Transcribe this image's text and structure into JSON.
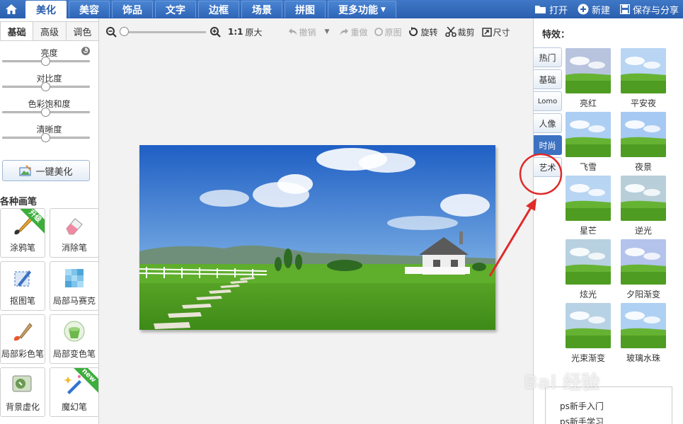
{
  "topbar": {
    "tabs": [
      {
        "label": "美化",
        "active": true
      },
      {
        "label": "美容"
      },
      {
        "label": "饰品"
      },
      {
        "label": "文字"
      },
      {
        "label": "边框"
      },
      {
        "label": "场景"
      },
      {
        "label": "拼图"
      },
      {
        "label": "更多功能"
      }
    ],
    "actions": {
      "open": "打开",
      "new": "新建",
      "save_share": "保存与分享"
    }
  },
  "left": {
    "subtabs": [
      "基础",
      "高级",
      "调色"
    ],
    "sliders": [
      {
        "label": "亮度",
        "value": 0.5
      },
      {
        "label": "对比度",
        "value": 0.5
      },
      {
        "label": "色彩饱和度",
        "value": 0.5
      },
      {
        "label": "清晰度",
        "value": 0.5
      }
    ],
    "onekey_label": "一键美化",
    "brush_section": "各种画笔",
    "brushes": [
      {
        "label": "涂鸦笔",
        "badge": "升级"
      },
      {
        "label": "消除笔"
      },
      {
        "label": "抠图笔"
      },
      {
        "label": "局部马赛克"
      },
      {
        "label": "局部彩色笔"
      },
      {
        "label": "局部变色笔"
      },
      {
        "label": "背景虚化"
      },
      {
        "label": "魔幻笔",
        "badge": "new"
      }
    ]
  },
  "toolbar": {
    "ratio": "1:1",
    "original_size": "原大",
    "undo": "撤销",
    "redo": "重做",
    "original": "原图",
    "rotate": "旋转",
    "crop": "裁剪",
    "resize": "尺寸",
    "zoom_value": 0.0
  },
  "right": {
    "title": "特效：",
    "categories": [
      {
        "label": "热门"
      },
      {
        "label": "基础"
      },
      {
        "label": "Lomo"
      },
      {
        "label": "人像"
      },
      {
        "label": "时尚",
        "active": true
      },
      {
        "label": "艺术"
      }
    ],
    "effects": [
      "亮红",
      "平安夜",
      "飞雪",
      "夜景",
      "星芒",
      "逆光",
      "炫光",
      "夕阳渐变",
      "光束渐变",
      "玻璃水珠"
    ],
    "bottom_links": [
      "ps新手入门",
      "ps新手学习"
    ]
  },
  "watermark": "Bai 经验",
  "colors": {
    "accent": "#2a5fae",
    "annotation": "#e02a2a",
    "active_tab": "#3d72c2"
  }
}
